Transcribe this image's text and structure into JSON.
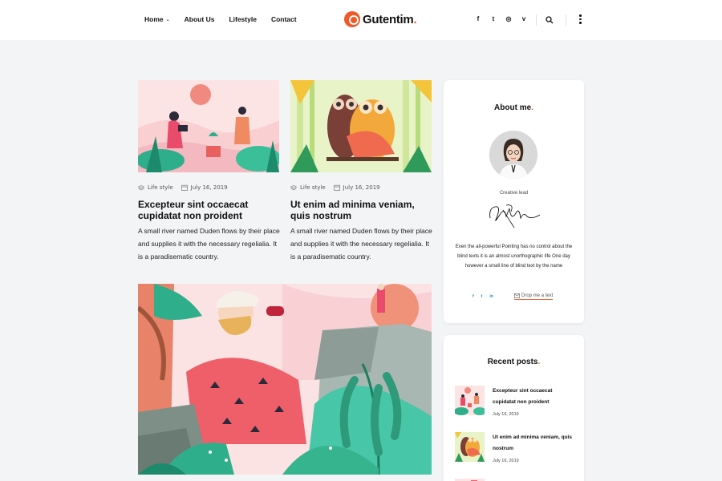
{
  "header": {
    "nav": [
      {
        "label": "Home",
        "has_caret": true
      },
      {
        "label": "About Us"
      },
      {
        "label": "Lifestyle"
      },
      {
        "label": "Contact"
      }
    ],
    "logo_text": "Gutentim",
    "logo_dot": ".",
    "social": [
      "facebook-icon",
      "twitter-icon",
      "instagram-icon",
      "vimeo-icon"
    ],
    "social_glyphs": [
      "f",
      "t",
      "◎",
      "v"
    ],
    "accent_color": "#f05a28"
  },
  "posts": [
    {
      "category": "Life style",
      "date": "July 16, 2019",
      "title": "Excepteur sint occaecat cupidatat non proident",
      "excerpt": "A small river named Duden flows by their place and supplies it with the necessary regelialia. It is a paradisematic country."
    },
    {
      "category": "Life style",
      "date": "July 16, 2019",
      "title": "Ut enim ad minima veniam, quis nostrum",
      "excerpt": "A small river named Duden flows by their place and supplies it with the necessary regelialia. It is a paradisematic country."
    }
  ],
  "sidebar": {
    "about": {
      "title": "About me",
      "title_dot": ".",
      "role": "Creative lead",
      "bio": "Even the all-powerful Pointing has no control about the blind texts it is an almost unorthographic life One day however a small line of blind text by the name",
      "social_glyphs": [
        "f",
        "t",
        "in"
      ],
      "drop_label": "Drop me a text"
    },
    "recent": {
      "title": "Recent posts",
      "title_dot": ".",
      "items": [
        {
          "title": "Excepteur sint occaecat cupidatat non proident",
          "date": "July 16, 2019"
        },
        {
          "title": "Ut enim ad minima veniam, quis nostrum",
          "date": "July 16, 2019"
        }
      ]
    }
  }
}
